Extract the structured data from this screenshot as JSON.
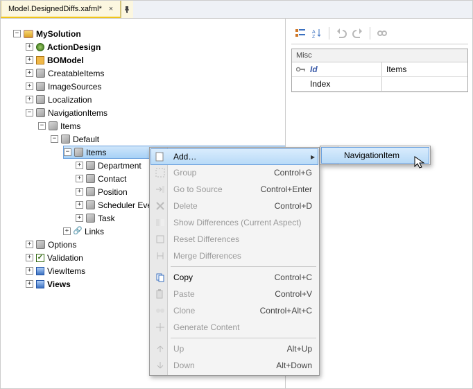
{
  "tab": {
    "title": "Model.DesignedDiffs.xafml*"
  },
  "tree": {
    "root": "MySolution",
    "actionDesign": "ActionDesign",
    "boModel": "BOModel",
    "creatableItems": "CreatableItems",
    "imageSources": "ImageSources",
    "localization": "Localization",
    "navigationItems": "NavigationItems",
    "items1": "Items",
    "default": "Default",
    "items2": "Items",
    "department": "Department",
    "contact": "Contact",
    "position": "Position",
    "schedulerEvent": "Scheduler Eve",
    "task": "Task",
    "links": "Links",
    "options": "Options",
    "validation": "Validation",
    "viewItems": "ViewItems",
    "views": "Views"
  },
  "contextMenu": {
    "add": "Add…",
    "group": "Group",
    "groupKey": "Control+G",
    "goToSource": "Go to Source",
    "goToSourceKey": "Control+Enter",
    "delete": "Delete",
    "deleteKey": "Control+D",
    "showDiff": "Show Differences (Current Aspect)",
    "resetDiff": "Reset Differences",
    "mergeDiff": "Merge Differences",
    "copy": "Copy",
    "copyKey": "Control+C",
    "paste": "Paste",
    "pasteKey": "Control+V",
    "clone": "Clone",
    "cloneKey": "Control+Alt+C",
    "generate": "Generate Content",
    "up": "Up",
    "upKey": "Alt+Up",
    "down": "Down",
    "downKey": "Alt+Down"
  },
  "submenu": {
    "navItem": "NavigationItem"
  },
  "propGrid": {
    "misc": "Misc",
    "id": "Id",
    "idVal": "Items",
    "index": "Index",
    "indexVal": ""
  }
}
